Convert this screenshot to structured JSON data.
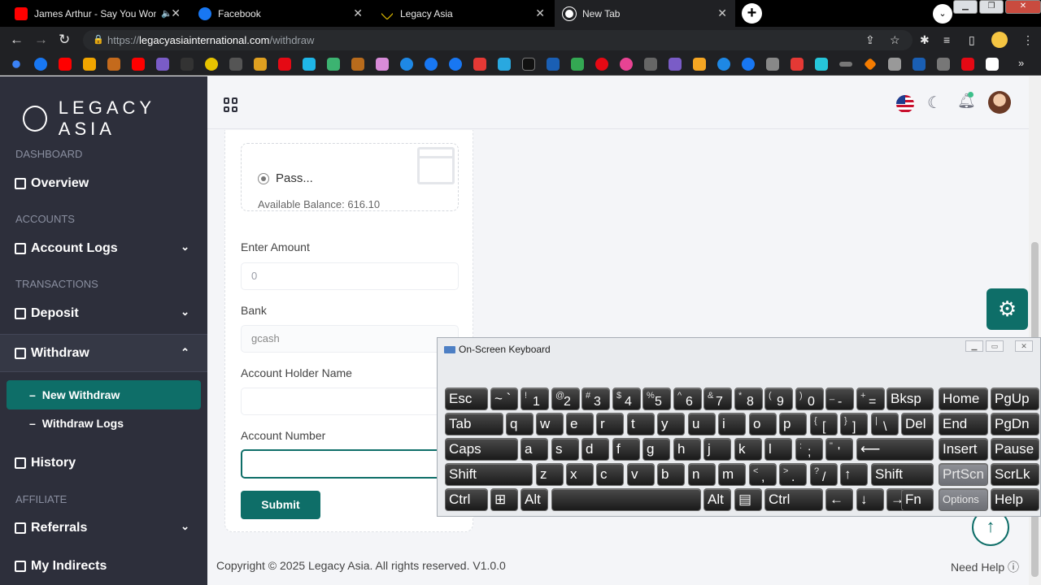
{
  "browser": {
    "tabs": [
      {
        "title": "James Arthur - Say You Won't",
        "fav_color": "#ff0000",
        "audio": "🔈"
      },
      {
        "title": "Facebook",
        "fav_color": "#1877f2"
      },
      {
        "title": "Legacy Asia",
        "fav_color": "#d4b200"
      },
      {
        "title": "New Tab",
        "fav_color": "#ffffff"
      }
    ],
    "url_prefix": "https://",
    "url_host": "legacyasiainternational.com",
    "url_path": "/withdraw"
  },
  "sidebar": {
    "brand": "LEGACY ASIA",
    "sections": {
      "dashboard": "DASHBOARD",
      "accounts": "ACCOUNTS",
      "transactions": "TRANSACTIONS",
      "affiliate": "AFFILIATE"
    },
    "items": {
      "overview": "Overview",
      "account_logs": "Account Logs",
      "deposit": "Deposit",
      "withdraw": "Withdraw",
      "new_withdraw": "New Withdraw",
      "withdraw_logs": "Withdraw Logs",
      "history": "History",
      "referrals": "Referrals",
      "my_indirects": "My Indirects"
    }
  },
  "form": {
    "method_name": "Pass...",
    "available_balance": "Available Balance: 616.10",
    "amount_label": "Enter Amount",
    "amount_placeholder": "0",
    "bank_label": "Bank",
    "bank_value": "gcash",
    "holder_label": "Account Holder Name",
    "holder_value": "",
    "number_label": "Account Number",
    "number_value": "",
    "submit_label": "Submit"
  },
  "footer": {
    "copyright": "Copyright © 2025 Legacy Asia. All rights reserved. V1.0.0",
    "help": "Need Help ⓘ"
  },
  "keyboard": {
    "title": "On-Screen Keyboard",
    "keys": {
      "esc": "Esc",
      "bksp": "Bksp",
      "home": "Home",
      "pgup": "PgUp",
      "tab": "Tab",
      "del": "Del",
      "end": "End",
      "pgdn": "PgDn",
      "caps": "Caps",
      "insert": "Insert",
      "pause": "Pause",
      "shift": "Shift",
      "prtscn": "PrtScn",
      "scrlk": "ScrLk",
      "ctrl": "Ctrl",
      "alt": "Alt",
      "fn": "Fn",
      "options": "Options",
      "help": "Help"
    }
  }
}
